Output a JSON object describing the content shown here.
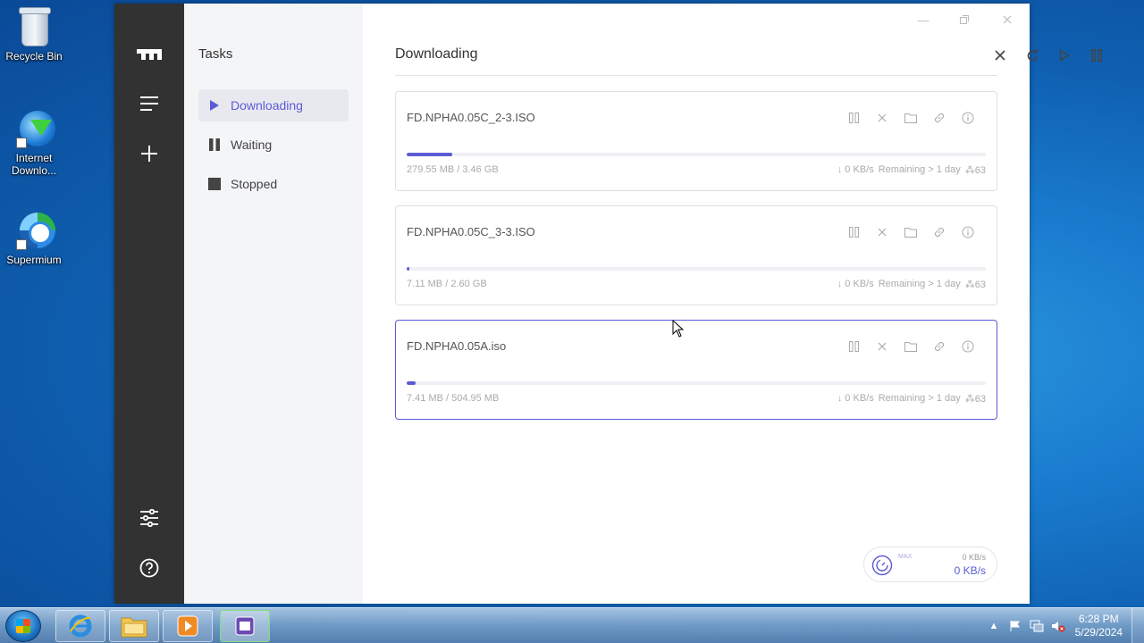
{
  "desktop": {
    "icons": [
      {
        "label": "Recycle Bin",
        "icon": "recycle-bin-icon"
      },
      {
        "label": "Internet Downlo...",
        "icon": "internet-download-manager-icon"
      },
      {
        "label": "Supermium",
        "icon": "supermium-icon"
      }
    ]
  },
  "app": {
    "rail": {
      "logo": "motrix-logo-icon",
      "menu": "menu-icon",
      "add": "add-icon",
      "settings": "settings-icon",
      "help": "help-icon"
    },
    "sidebar": {
      "title": "Tasks",
      "items": [
        {
          "label": "Downloading",
          "icon": "play-icon",
          "active": true
        },
        {
          "label": "Waiting",
          "icon": "pause-icon",
          "active": false
        },
        {
          "label": "Stopped",
          "icon": "stop-icon",
          "active": false
        }
      ]
    },
    "main": {
      "title": "Downloading",
      "toolbar": [
        "delete-all-icon",
        "refresh-icon",
        "resume-all-icon",
        "pause-all-icon"
      ],
      "tasks": [
        {
          "name": "FD.NPHA0.05C_2-3.ISO",
          "size": "279.55 MB / 3.46 GB",
          "speed": "↓ 0 KB/s",
          "remaining": "Remaining > 1 day",
          "connections": "63",
          "progress": 0.079,
          "selected": false
        },
        {
          "name": "FD.NPHA0.05C_3-3.ISO",
          "size": "7.11 MB / 2.60 GB",
          "speed": "↓ 0 KB/s",
          "remaining": "Remaining > 1 day",
          "connections": "63",
          "progress": 0.003,
          "selected": false
        },
        {
          "name": "FD.NPHA0.05A.iso",
          "size": "7.41 MB / 504.95 MB",
          "speed": "↓ 0 KB/s",
          "remaining": "Remaining > 1 day",
          "connections": "63",
          "progress": 0.015,
          "selected": true
        }
      ],
      "speedometer": {
        "max_label": "MAX",
        "upload": "0 KB/s",
        "download": "0 KB/s"
      }
    }
  },
  "taskbar": {
    "apps": [
      "internet-explorer-icon",
      "file-explorer-icon",
      "media-player-icon",
      "motrix-app-icon"
    ],
    "clock": {
      "time": "6:28 PM",
      "date": "5/29/2024"
    }
  },
  "colors": {
    "accent": "#5b5bd6",
    "rail": "#323232",
    "sidebar": "#f4f5f7"
  }
}
